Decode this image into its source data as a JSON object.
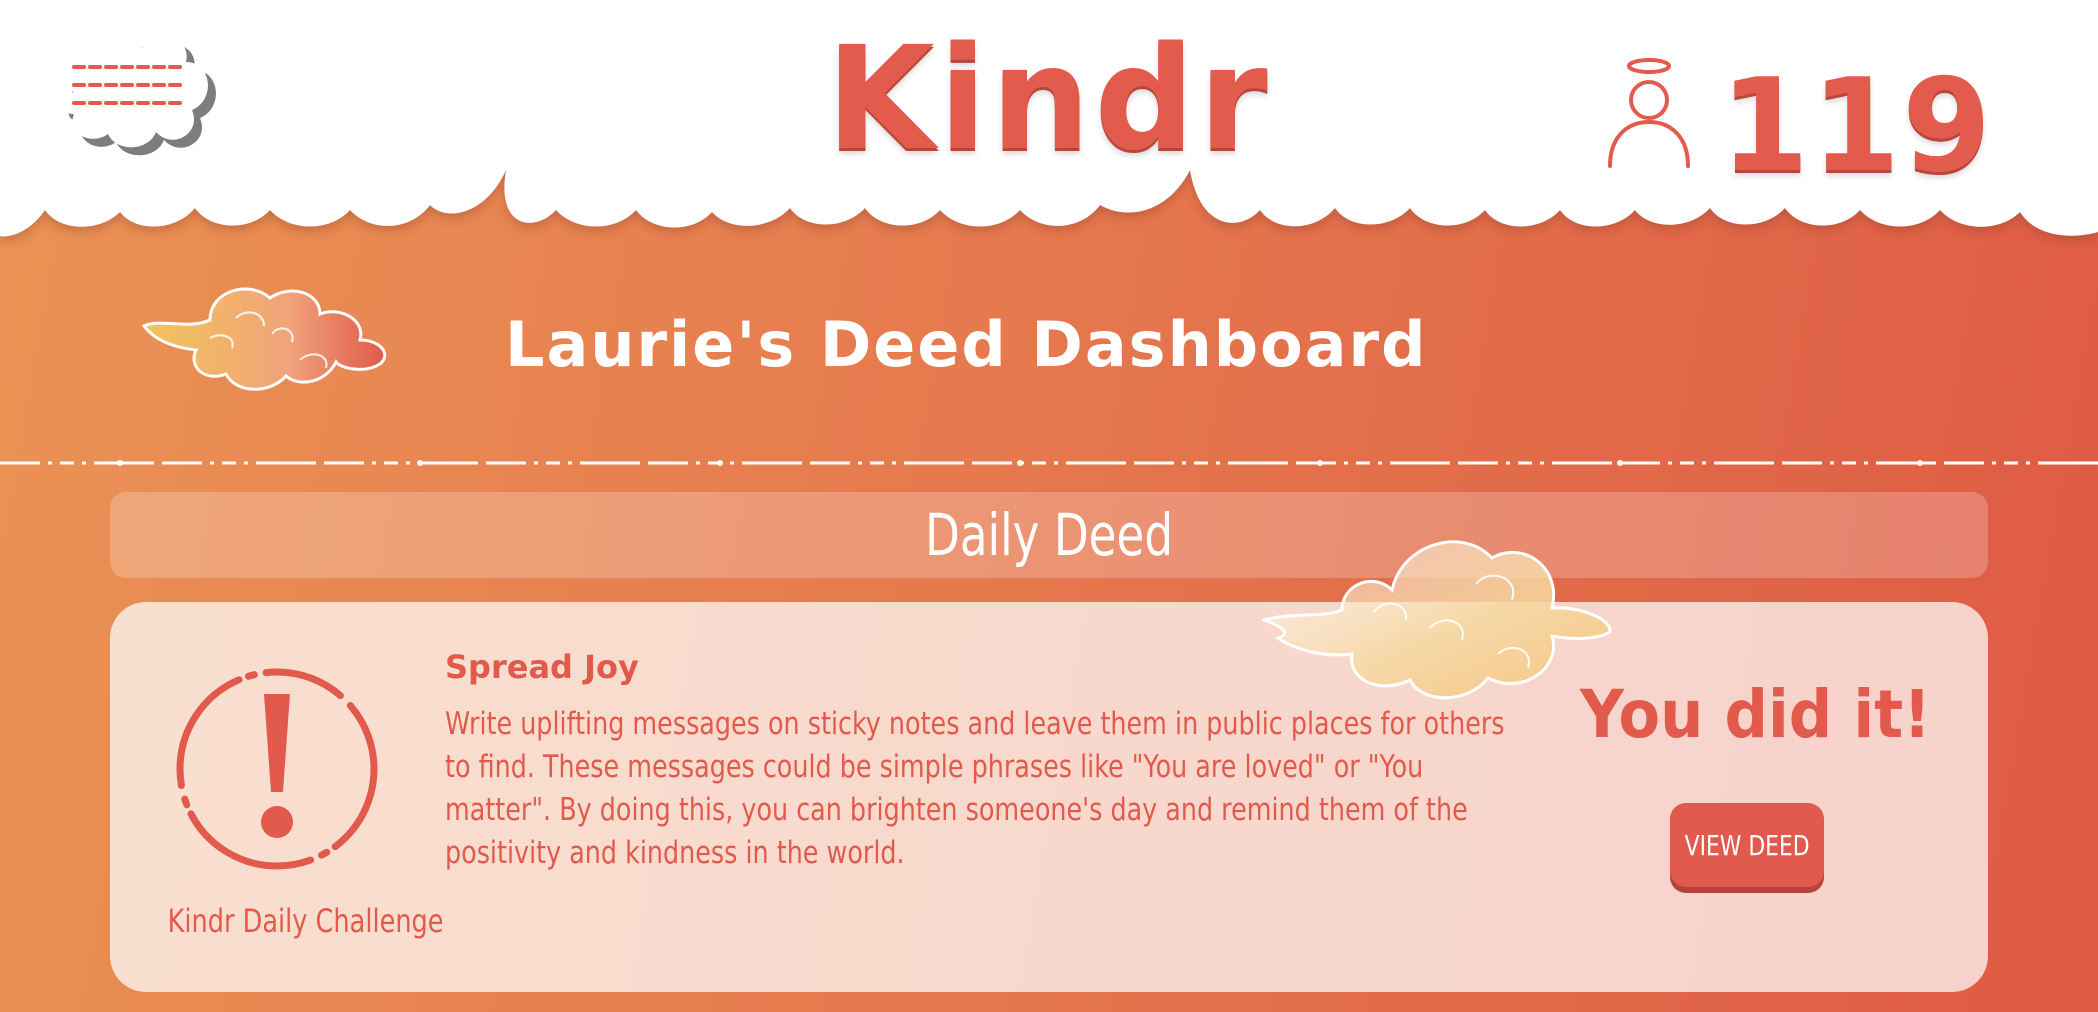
{
  "header": {
    "menu_icon": "menu-cloud-icon",
    "logo": "Kindr",
    "profile_icon": "angel-profile-icon",
    "points": "119"
  },
  "dashboard": {
    "title": "Laurie's Deed Dashboard"
  },
  "daily_deed": {
    "banner_label": "Daily Deed",
    "challenge_icon": "exclamation-icon",
    "challenge_label": "Kindr Daily Challenge",
    "title": "Spread Joy",
    "description": "Write uplifting messages on sticky notes and leave them in public places for others to find. These messages could be simple phrases like \"You are loved\" or \"You matter\". By doing this, you can brighten someone's day and remind them of the positivity and kindness in the world.",
    "status_text": "You did it!",
    "view_button": "VIEW DEED"
  },
  "colors": {
    "accent": "#e35b4c",
    "background_start": "#ea9355",
    "background_end": "#de5a44",
    "card": "#f8dbd2"
  }
}
